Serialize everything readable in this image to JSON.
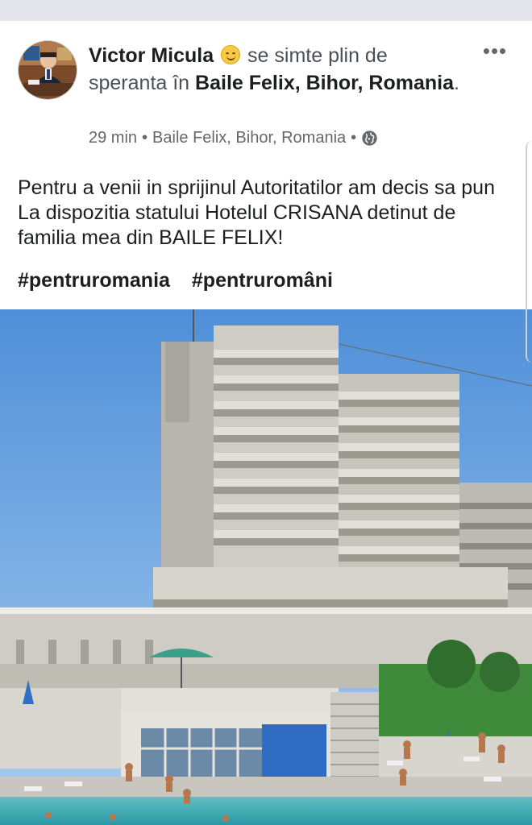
{
  "post": {
    "author": "Victor Micula",
    "feeling_text": "se simte plin de speranta în",
    "place": "Baile Felix, Bihor, Romania",
    "period": ".",
    "time": "29 min",
    "separator": "•",
    "location": "Baile Felix, Bihor, Romania",
    "privacy_icon": "globe-icon",
    "feeling_icon": "smiling-face-emoji",
    "more_icon": "more-options-icon",
    "more_label": "•••",
    "body": "Pentru a venii in sprijinul Autoritatilor am decis sa pun La dispozitia statului Hotelul CRISANA detinut de familia mea din BAILE FELIX!",
    "hashtags": [
      "#pentruromania",
      "#pentruromâni"
    ]
  }
}
